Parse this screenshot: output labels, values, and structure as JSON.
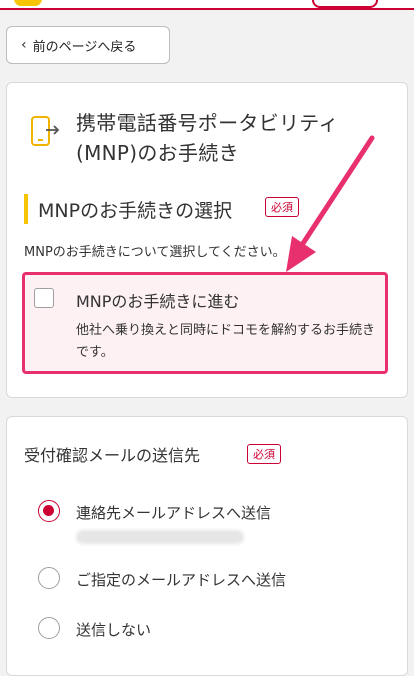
{
  "back_button": {
    "label": "前のページへ戻る",
    "icon": "chevron-left-icon"
  },
  "mnp_card": {
    "icon": "phone-transfer-icon",
    "title": "携帯電話番号ポータビリティ(MNP)のお手続き",
    "section_title": "MNPのお手続きの選択",
    "required_label": "必須",
    "instruction": "MNPのお手続きについて選択してください。",
    "option": {
      "label": "MNPのお手続きに進む",
      "description": "他社へ乗り換えと同時にドコモを解約するお手続きです。",
      "checked": false
    }
  },
  "email_card": {
    "title": "受付確認メールの送信先",
    "required_label": "必須",
    "options": [
      {
        "label": "連絡先メールアドレスへ送信",
        "checked": true
      },
      {
        "label": "ご指定のメールアドレスへ送信",
        "checked": false
      },
      {
        "label": "送信しない",
        "checked": false
      }
    ]
  },
  "colors": {
    "accent_red": "#cc0033",
    "highlight_pink": "#e8306f",
    "section_bar_yellow": "#f6c400"
  }
}
